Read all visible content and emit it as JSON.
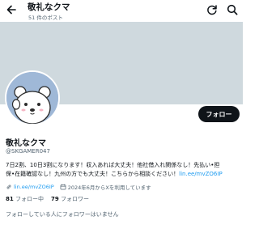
{
  "header": {
    "title": "敬礼なクマ",
    "post_count": "51 件のポスト",
    "icons": [
      "back-arrow-icon",
      "refresh-icon",
      "search-icon"
    ]
  },
  "profile": {
    "display_name": "敬礼なクマ",
    "handle": "@SKGAMER047",
    "follow_label": "フォロー",
    "bio_line1_text": "7日2割、10日3割になります！収入あれば大丈夫！他社借入れ関係なし！先払い•担",
    "bio_line2_text": "保•在籍確認なし！九州の方でも大丈夫！こちらから相談ください！",
    "bio_link": "lin.ee/mvZO6IP",
    "website": "lin.ee/mvZO6IP",
    "joined": "2024年6月からXを利用しています",
    "following_count": "81",
    "following_label": "フォロー中",
    "followers_count": "79",
    "followers_label": "フォロワー",
    "mutual_followers_text": "フォローしている人にフォロワーはいません"
  },
  "colors": {
    "accent": "#1d9bf0",
    "banner": "#cfd9de",
    "avatar_bg": "#9fb8d7",
    "follow_button_bg": "#0f1419",
    "secondary_text": "#536471"
  }
}
